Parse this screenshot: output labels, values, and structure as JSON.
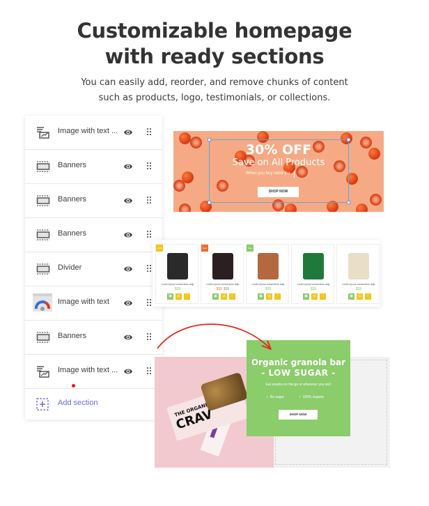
{
  "header": {
    "title_line1": "Customizable homepage",
    "title_line2": "with ready sections",
    "subtitle_line1": "You can easily add, reorder, and remove chunks of content",
    "subtitle_line2": "such as products, logo, testimonials, or collections."
  },
  "sections_panel": {
    "items": [
      {
        "label": "Image with text ...",
        "icon": "image-with-text-icon"
      },
      {
        "label": "Banners",
        "icon": "banner-icon"
      },
      {
        "label": "Banners",
        "icon": "banner-icon"
      },
      {
        "label": "Banners",
        "icon": "banner-icon"
      },
      {
        "label": "Divider",
        "icon": "banner-icon"
      },
      {
        "label": "Image with text",
        "icon": "speedometer-thumbnail-icon"
      },
      {
        "label": "Banners",
        "icon": "banner-icon"
      },
      {
        "label": "Image with text ...",
        "icon": "image-with-text-icon"
      }
    ],
    "visibility_icon": "eye-icon",
    "drag_icon": "drag-handle-icon",
    "add_section_label": "Add section"
  },
  "promo_banner": {
    "title": "30% OFF",
    "subtitle": "Save on All Products",
    "text": "When you buy more tha",
    "button": "SHOP NOW",
    "background": "#f5aa85"
  },
  "products": {
    "items": [
      {
        "badge": "-30%",
        "badge_color": "#f5c518",
        "image_color": "#2a2a2a",
        "name": "Lorem ipsum consectetur adip",
        "price": "$25",
        "old_price": "",
        "price_color": "#7fc65a"
      },
      {
        "badge": "Sale",
        "badge_color": "#f26b2f",
        "image_color": "#2b1f22",
        "name": "Lorem ipsum consectetur adip",
        "price": "$25",
        "old_price": "$35",
        "price_color": "#f26b2f"
      },
      {
        "badge": "New",
        "badge_color": "#8bcc6b",
        "image_color": "#b4683f",
        "name": "Lorem ipsum consectetur adip",
        "price": "$25",
        "old_price": "",
        "price_color": "#7fc65a"
      },
      {
        "badge": "",
        "badge_color": "",
        "image_color": "#1f7a3a",
        "name": "Lorem ipsum consectetur adip",
        "price": "$25",
        "old_price": "",
        "price_color": "#7fc65a"
      },
      {
        "badge": "",
        "badge_color": "",
        "image_color": "#e9dfc7",
        "name": "Lorem ipsum consectetur adip",
        "price": "$25",
        "old_price": "",
        "price_color": "#7fc65a"
      }
    ],
    "buttons": [
      {
        "icon": "cart-icon",
        "color": "#8bcc6b"
      },
      {
        "icon": "search-icon",
        "color": "#f5c518"
      },
      {
        "icon": "heart-icon",
        "color": "#f5c518"
      }
    ]
  },
  "granola": {
    "title": "Organic granola bar",
    "subtitle": "- LOW SUGAR -",
    "text": "Eat snacks on the go or wherever you are!",
    "feature1": "✓  No sugar",
    "feature2": "✓  100% organic",
    "button": "SHOP NOW",
    "wrapper_brand_small": "THE ORGANIC",
    "wrapper_brand_big": "CRAV",
    "background": "#8bcc6b"
  }
}
